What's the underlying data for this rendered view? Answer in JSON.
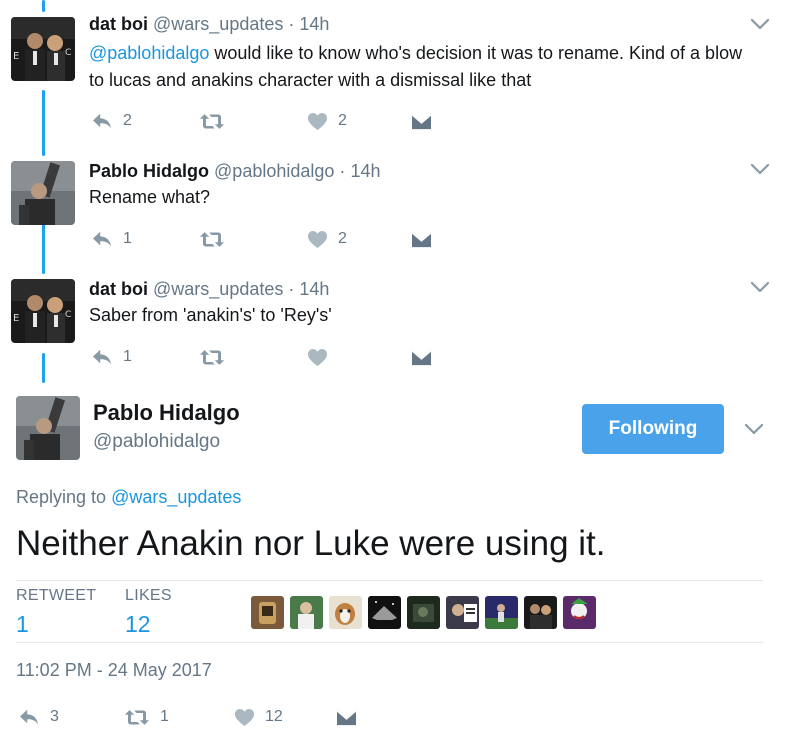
{
  "tweets": [
    {
      "name": "dat boi",
      "handle": "@wars_updates",
      "time": "14h",
      "mention": "@pablohidalgo",
      "text_line1": " would like to know who's decision it was to rename. Kind of a blow",
      "text_line2": "to lucas and anakins character with a dismissal like that",
      "reply_count": "2",
      "retweet_count": "",
      "like_count": "2"
    },
    {
      "name": "Pablo Hidalgo",
      "handle": "@pablohidalgo",
      "time": "14h",
      "text": "Rename what?",
      "reply_count": "1",
      "retweet_count": "",
      "like_count": "2"
    },
    {
      "name": "dat boi",
      "handle": "@wars_updates",
      "time": "14h",
      "text": "Saber from 'anakin's' to 'Rey's'",
      "reply_count": "1",
      "retweet_count": "",
      "like_count": ""
    }
  ],
  "main": {
    "name": "Pablo Hidalgo",
    "handle": "@pablohidalgo",
    "follow_label": "Following",
    "replying_prefix": "Replying to ",
    "replying_to": "@wars_updates",
    "text": "Neither Anakin nor Luke were using it.",
    "retweets_label": "RETWEET",
    "retweets_value": "1",
    "likes_label": "LIKES",
    "likes_value": "12",
    "timestamp": "11:02 PM - 24 May 2017",
    "reply_count": "3",
    "retweet_count": "1",
    "like_count": "12"
  },
  "colors": {
    "accent": "#1da1f2",
    "link": "#1b95e0",
    "muted": "#657786",
    "follow_button": "#4aa3ea"
  },
  "icons": [
    "reply-icon",
    "retweet-icon",
    "like-icon",
    "direct-message-icon",
    "chevron-down-icon"
  ]
}
